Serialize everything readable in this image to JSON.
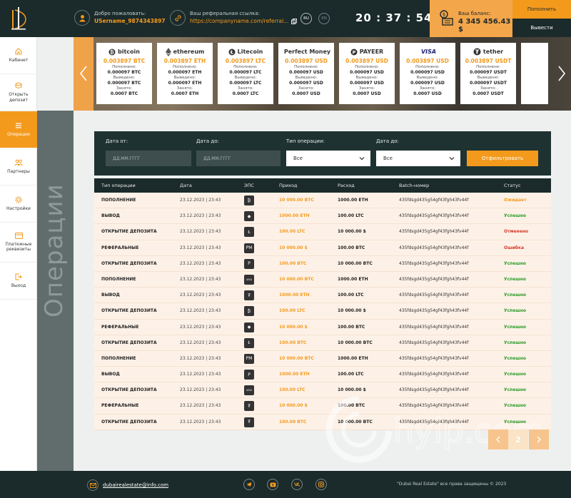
{
  "header": {
    "welcome_label": "Добро пожаловать:",
    "username": "USername_9874343897",
    "ref_label": "Ваш реферальная ссылка:",
    "ref_link": "https://companyname.com/referral...",
    "lang_ru": "RU",
    "lang_en": "EN",
    "time": "20 : 37 : 54",
    "balance_label": "Ваш баланс:",
    "balance_value": "4 345 456.43 $",
    "topup_label": "Пополнить",
    "withdraw_label": "Вывести"
  },
  "sidebar": {
    "items": [
      {
        "label": "Кабинет"
      },
      {
        "label": "Открыть депозит"
      },
      {
        "label": "Операции"
      },
      {
        "label": "Партнеры"
      },
      {
        "label": "Настройки"
      },
      {
        "label": "Платежные реквизиты"
      },
      {
        "label": "Выход"
      }
    ],
    "active_index": 2
  },
  "section_title": "Операции",
  "wallets": [
    {
      "name": "bitcoin",
      "amount": "0.003897 BTC",
      "in_label": "Пополнено:",
      "in": "0.000097 BTC",
      "out_label": "Выведено:",
      "out": "0.000097 BTC",
      "busy_label": "Занято:",
      "busy": "0.0007 BTC"
    },
    {
      "name": "ethereum",
      "amount": "0.003897 ETH",
      "in_label": "Пополнено:",
      "in": "0.000097 ETH",
      "out_label": "Выведено:",
      "out": "0.000097 ETH",
      "busy_label": "Занято:",
      "busy": "0.0007 ETH"
    },
    {
      "name": "Litecoin",
      "amount": "0.003897 LTC",
      "in_label": "Пополнено:",
      "in": "0.000097 LTC",
      "out_label": "Выведено:",
      "out": "0.000097 LTC",
      "busy_label": "Занято:",
      "busy": "0.0007 LTC"
    },
    {
      "name": "Perfect Money",
      "amount": "0.003897 USD",
      "in_label": "Пополнено:",
      "in": "0.000097 USD",
      "out_label": "Выведено:",
      "out": "0.000097 USD",
      "busy_label": "Занято:",
      "busy": "0.0007 USD"
    },
    {
      "name": "PAYEER",
      "amount": "0.003897 USD",
      "in_label": "Пополнено:",
      "in": "0.000097 USD",
      "out_label": "Выведено:",
      "out": "0.000097 USD",
      "busy_label": "Занято:",
      "busy": "0.0007 USD"
    },
    {
      "name": "VISA",
      "amount": "0.003897 USD",
      "in_label": "Пополнено:",
      "in": "0.000097 USD",
      "out_label": "Выведено:",
      "out": "0.000097 USD",
      "busy_label": "Занято:",
      "busy": "0.0007 USD"
    },
    {
      "name": "tether",
      "amount": "0.003897 USDT",
      "in_label": "Пополнено:",
      "in": "0.000097 USDT",
      "out_label": "Выведено:",
      "out": "0.000097 USDT",
      "busy_label": "Занято:",
      "busy": "0.0007 USDT"
    }
  ],
  "filter": {
    "date_from_label": "Дата от:",
    "date_from_placeholder": "ДД.ММ.ГГГГ",
    "date_to_label": "Дата до:",
    "date_to_placeholder": "ДД.ММ.ГГГГ",
    "op_type_label": "Тип операции:",
    "op_type_value": "Все",
    "date_label": "Дата до:",
    "date_value": "Все",
    "button_label": "Отфильтровать"
  },
  "table": {
    "headers": [
      "Тип операции",
      "Дата",
      "ЭПС",
      "Приход",
      "Расход",
      "Batch-номер",
      "Статус"
    ],
    "rows": [
      {
        "type": "ПОПОЛНЕНИЕ",
        "date": "23.12.2023 | 23:43",
        "eps": "btc",
        "in": "10 000.00 BTC",
        "out": "1000.00 ETH",
        "batch": "435fdsgd435g54gf43fgh43fv44f",
        "status": "Ожидает",
        "status_color": "#f39a1d"
      },
      {
        "type": "ВЫВОД",
        "date": "23.12.2023 | 23:43",
        "eps": "eth",
        "in": "1000.00 ETH",
        "out": "100.00 LTC",
        "batch": "435fdsgd435g54gf43fgh43fv44f",
        "status": "Успешно",
        "status_color": "#2a9d2a"
      },
      {
        "type": "ОТКРЫТИЕ ДЕПОЗИТА",
        "date": "23.12.2023 | 23:43",
        "eps": "ltc",
        "in": "100.00 LTC",
        "out": "10 000.00 $",
        "batch": "435fdsgd435g54gf43fgh43fv44f",
        "status": "Отменено",
        "status_color": "#d43a2a"
      },
      {
        "type": "РЕФЕРАЛЬНЫЕ",
        "date": "23.12.2023 | 23:43",
        "eps": "pm",
        "in": "10 000.00 $",
        "out": "100.00 BTC",
        "batch": "435fdsgd435g54gf43fgh43fv44f",
        "status": "Ошибка",
        "status_color": "#d43a2a"
      },
      {
        "type": "ОТКРЫТИЕ ДЕПОЗИТА",
        "date": "23.12.2023 | 23:43",
        "eps": "payeer",
        "in": "100.00 BTC",
        "out": "10 000.00 BTC",
        "batch": "435fdsgd435g54gf43fgh43fv44f",
        "status": "Успешно",
        "status_color": "#2a9d2a"
      },
      {
        "type": "ПОПОЛНЕНИЕ",
        "date": "23.12.2023 | 23:43",
        "eps": "visa",
        "in": "10 000.00 BTC",
        "out": "1000.00 ETH",
        "batch": "435fdsgd435g54gf43fgh43fv44f",
        "status": "Успешно",
        "status_color": "#2a9d2a"
      },
      {
        "type": "ВЫВОД",
        "date": "23.12.2023 | 23:43",
        "eps": "tether",
        "in": "1000.00 ETH",
        "out": "100.00 LTC",
        "batch": "435fdsgd435g54gf43fgh43fv44f",
        "status": "Успешно",
        "status_color": "#2a9d2a"
      },
      {
        "type": "ОТКРЫТИЕ ДЕПОЗИТА",
        "date": "23.12.2023 | 23:43",
        "eps": "btc",
        "in": "100.00 LTC",
        "out": "10 000.00 $",
        "batch": "435fdsgd435g54gf43fgh43fv44f",
        "status": "Успешно",
        "status_color": "#2a9d2a"
      },
      {
        "type": "РЕФЕРАЛЬНЫЕ",
        "date": "23.12.2023 | 23:43",
        "eps": "eth",
        "in": "10 000.00 $",
        "out": "100.00 BTC",
        "batch": "435fdsgd435g54gf43fgh43fv44f",
        "status": "Успешно",
        "status_color": "#2a9d2a"
      },
      {
        "type": "ОТКРЫТИЕ ДЕПОЗИТА",
        "date": "23.12.2023 | 23:43",
        "eps": "ltc",
        "in": "100.00 BTC",
        "out": "10 000.00 BTC",
        "batch": "435fdsgd435g54gf43fgh43fv44f",
        "status": "Успешно",
        "status_color": "#2a9d2a"
      },
      {
        "type": "ПОПОЛНЕНИЕ",
        "date": "23.12.2023 | 23:43",
        "eps": "pm",
        "in": "10 000.00 BTC",
        "out": "1000.00 ETH",
        "batch": "435fdsgd435g54gf43fgh43fv44f",
        "status": "Успешно",
        "status_color": "#2a9d2a"
      },
      {
        "type": "ВЫВОД",
        "date": "23.12.2023 | 23:43",
        "eps": "payeer",
        "in": "1000.00 ETH",
        "out": "100.00 LTC",
        "batch": "435fdsgd435g54gf43fgh43fv44f",
        "status": "Успешно",
        "status_color": "#2a9d2a"
      },
      {
        "type": "ОТКРЫТИЕ ДЕПОЗИТА",
        "date": "23.12.2023 | 23:43",
        "eps": "visa",
        "in": "100.00 LTC",
        "out": "10 000.00 $",
        "batch": "435fdsgd435g54gf43fgh43fv44f",
        "status": "Успешно",
        "status_color": "#2a9d2a"
      },
      {
        "type": "РЕФЕРАЛЬНЫЕ",
        "date": "23.12.2023 | 23:43",
        "eps": "tether",
        "in": "10 000.00 $",
        "out": "100.00 BTC",
        "batch": "435fdsgd435g54gf43fgh43fv44f",
        "status": "Успешно",
        "status_color": "#2a9d2a"
      },
      {
        "type": "ОТКРЫТИЕ ДЕПОЗИТА",
        "date": "23.12.2023 | 23:43",
        "eps": "tether",
        "in": "100.00 BTC",
        "out": "10 000.00 BTC",
        "batch": "435fdsgd435g54gf43fgh43fv44f",
        "status": "Успешно",
        "status_color": "#2a9d2a"
      }
    ]
  },
  "pagination": {
    "current_page": "2"
  },
  "footer": {
    "email": "dubairealestate@info.com",
    "copyright": "\"Dubai Real Estate\" все права защищены © 2023",
    "socials": [
      "telegram-icon",
      "youtube-icon",
      "vk-icon",
      "instagram-icon"
    ]
  },
  "watermark": "hyip.com",
  "colors": {
    "accent": "#f39a1d",
    "dark": "#1b2a2a",
    "balance_bg": "#f4a64a",
    "row_bg": "#fdf1e7",
    "success": "#2a9d2a",
    "error": "#d43a2a"
  }
}
